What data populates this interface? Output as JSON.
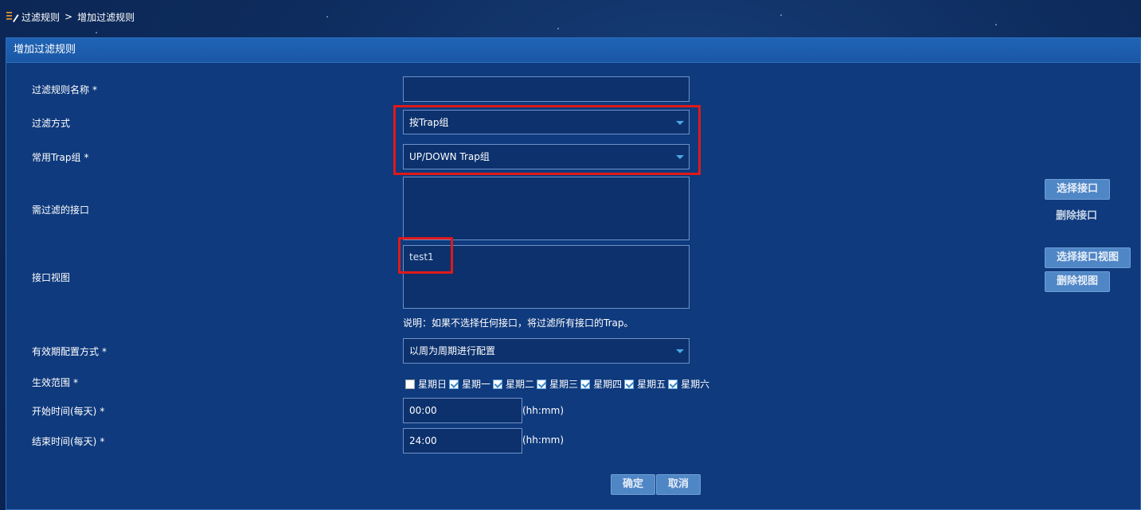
{
  "breadcrumb": {
    "parent": "过滤规则",
    "separator": ">",
    "current": "增加过滤规则"
  },
  "panel": {
    "title": "增加过滤规则"
  },
  "form": {
    "rule_name": {
      "label": "过滤规则名称",
      "required": "*",
      "value": ""
    },
    "filter_mode": {
      "label": "过滤方式",
      "value": "按Trap组"
    },
    "trap_group": {
      "label": "常用Trap组",
      "required": "*",
      "value": "UP/DOWN Trap组"
    },
    "interfaces": {
      "label": "需过滤的接口",
      "items": []
    },
    "interface_view": {
      "label": "接口视图",
      "items": [
        "test1"
      ]
    },
    "note": "说明：如果不选择任何接口，将过滤所有接口的Trap。",
    "validity_mode": {
      "label": "有效期配置方式",
      "required": "*",
      "value": "以周为周期进行配置"
    },
    "effective_range": {
      "label": "生效范围",
      "required": "*",
      "days": [
        {
          "label": "星期日",
          "checked": false
        },
        {
          "label": "星期一",
          "checked": true
        },
        {
          "label": "星期二",
          "checked": true
        },
        {
          "label": "星期三",
          "checked": true
        },
        {
          "label": "星期四",
          "checked": true
        },
        {
          "label": "星期五",
          "checked": true
        },
        {
          "label": "星期六",
          "checked": true
        }
      ]
    },
    "start_time": {
      "label": "开始时间(每天)",
      "required": "*",
      "value": "00:00",
      "hint": "(hh:mm)"
    },
    "end_time": {
      "label": "结束时间(每天)",
      "required": "*",
      "value": "24:00",
      "hint": "(hh:mm)"
    }
  },
  "buttons": {
    "select_interface": "选择接口",
    "delete_interface": "删除接口",
    "select_interface_view": "选择接口视图",
    "delete_view": "删除视图",
    "confirm": "确定",
    "cancel": "取消"
  },
  "colors": {
    "background": "#0d2b5c",
    "panel": "#0f3a7d",
    "header": "#1a58a6",
    "button": "#4f86c6",
    "highlight": "#e01919"
  }
}
